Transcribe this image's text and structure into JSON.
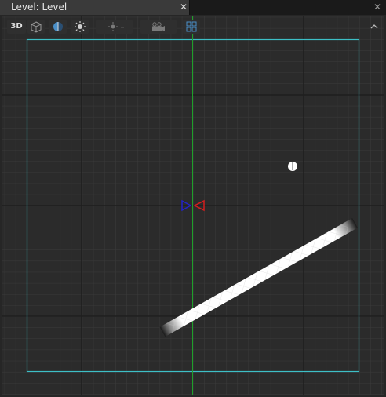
{
  "tab": {
    "title": "Level: Level",
    "close_glyph": "✕"
  },
  "panel": {
    "close_glyph": "✕"
  },
  "toolbar": {
    "view_mode_label": "3D",
    "buttons": [
      {
        "name": "view-mode-button",
        "icon": "3d-text"
      },
      {
        "name": "perspective-cube-button",
        "icon": "cube-icon"
      },
      {
        "name": "lit-mode-button",
        "icon": "half-sphere-icon"
      },
      {
        "name": "lighting-toggle-button",
        "icon": "sun-icon"
      },
      {
        "name": "light-settings-button",
        "icon": "sun-dropdown-icon"
      },
      {
        "name": "camera-button",
        "icon": "camera-icon"
      },
      {
        "name": "grid-toggle-button",
        "icon": "grid-icon"
      }
    ],
    "collapse_icon": "chevron-up-icon"
  },
  "colors": {
    "viewport_bg": "#2b2b2b",
    "grid_minor": "#3b3b3b",
    "grid_major": "#1e1e1e",
    "boundary": "#3dbfc6",
    "x_axis": "#b01e1e",
    "y_axis": "#1fa02a",
    "camera_blue": "#2323c8",
    "camera_red": "#d21e1e",
    "light_marker": "#ffffff",
    "active_icon": "#4a8fc8"
  },
  "scene_objects": [
    {
      "name": "level-boundary",
      "type": "rectangle"
    },
    {
      "name": "x-axis-line",
      "type": "axis"
    },
    {
      "name": "y-axis-line",
      "type": "axis"
    },
    {
      "name": "camera-gizmo",
      "type": "gizmo"
    },
    {
      "name": "light-marker",
      "type": "point-light"
    },
    {
      "name": "platform-bar",
      "type": "sprite"
    }
  ]
}
